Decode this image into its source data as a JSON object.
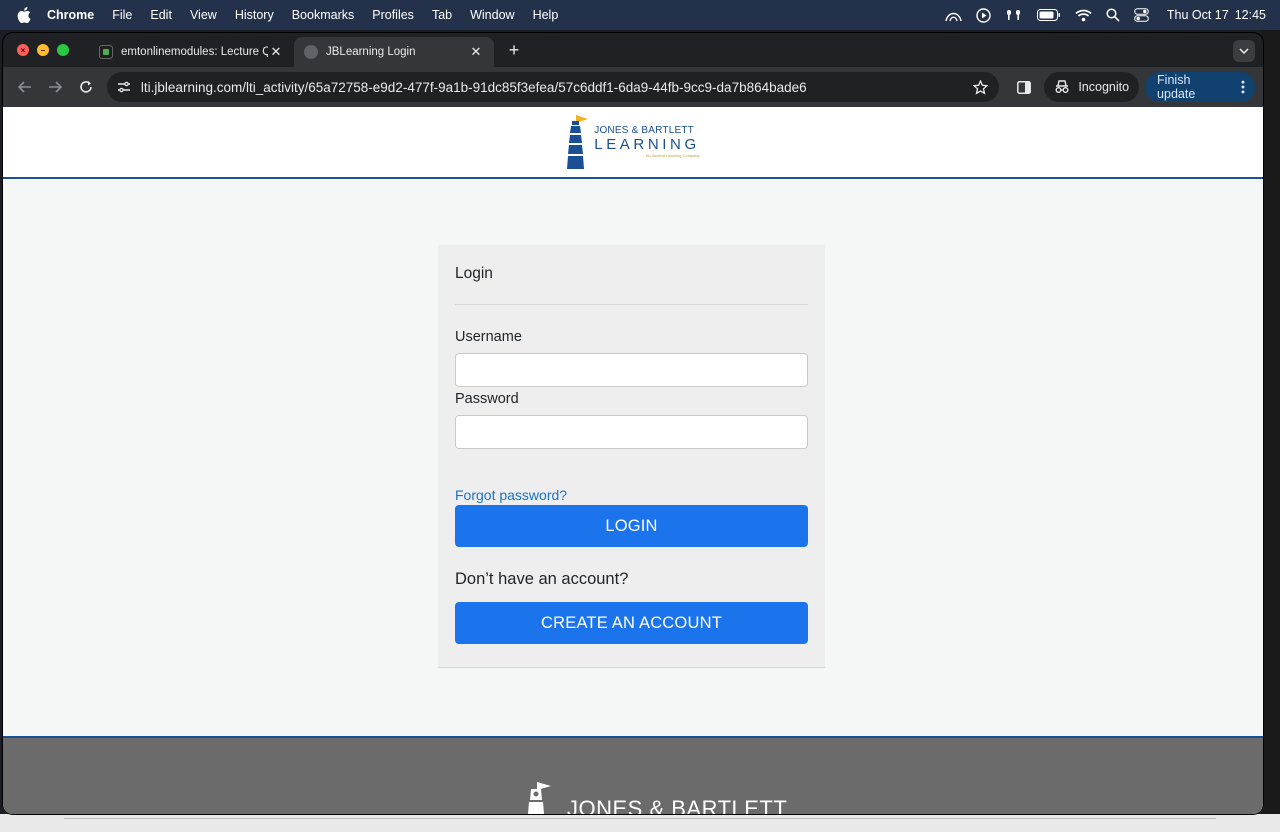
{
  "menubar": {
    "app_name": "Chrome",
    "items": [
      "File",
      "Edit",
      "View",
      "History",
      "Bookmarks",
      "Profiles",
      "Tab",
      "Window",
      "Help"
    ],
    "clock_date": "Thu Oct 17",
    "clock_time": "12:45"
  },
  "tabs": [
    {
      "title": "emtonlinemodules: Lecture Q",
      "active": false
    },
    {
      "title": "JBLearning Login",
      "active": true
    }
  ],
  "toolbar": {
    "url": "lti.jblearning.com/lti_activity/65a72758-e9d2-477f-9a1b-91dc85f3efea/57c6ddf1-6da9-44fb-9cc9-da7b864bade6",
    "incognito_label": "Incognito",
    "finish_update_label": "Finish update"
  },
  "header": {
    "logo_line1": "JONES & BARTLETT",
    "logo_line2": "LEARNING",
    "logo_tagline": "An Ascend Learning Company"
  },
  "login": {
    "title": "Login",
    "username_label": "Username",
    "username_value": "",
    "password_label": "Password",
    "password_value": "",
    "forgot_link": "Forgot password?",
    "login_button": "LOGIN",
    "no_account_text": "Don’t have an account?",
    "create_button": "CREATE AN ACCOUNT"
  },
  "footer": {
    "logo_text": "JONES & BARTLETT"
  },
  "colors": {
    "brand_blue": "#1a4f95",
    "button_blue": "#1b74eb",
    "link_blue": "#1a73c9",
    "logo_gold": "#f0b323"
  }
}
